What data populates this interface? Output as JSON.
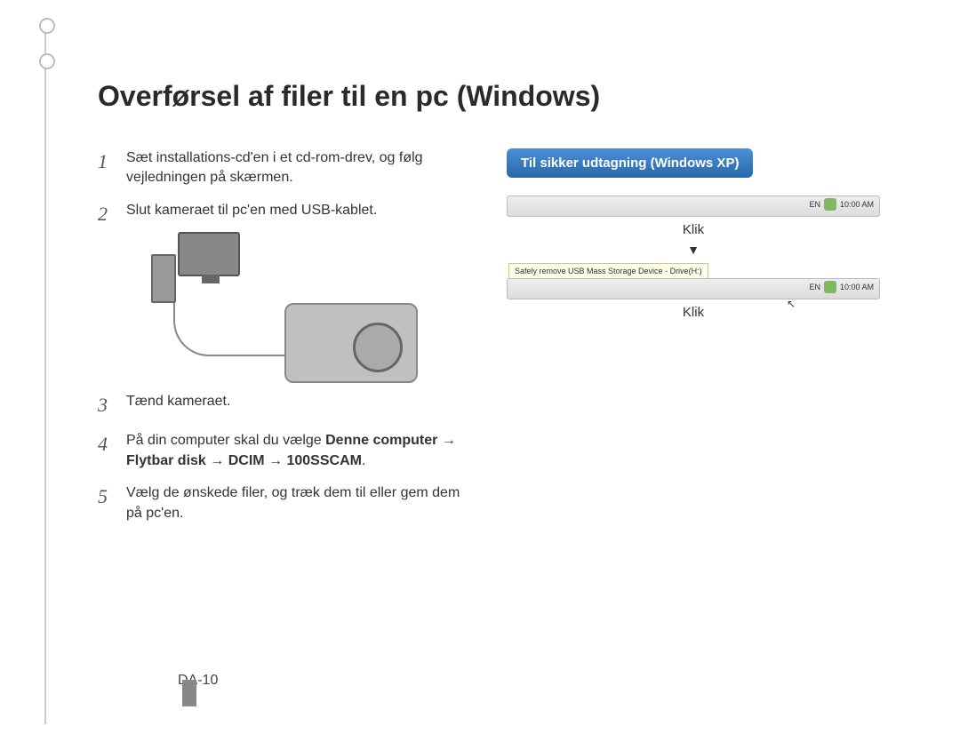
{
  "title": "Overførsel af filer til en pc (Windows)",
  "steps": {
    "s1_num": "1",
    "s1": "Sæt installations-cd'en i et cd-rom-drev, og følg vejledningen på skærmen.",
    "s2_num": "2",
    "s2": "Slut kameraet til pc'en med USB-kablet.",
    "s3_num": "3",
    "s3": "Tænd kameraet.",
    "s4_num": "4",
    "s4_pre": "På din computer skal du vælge ",
    "s4_b1": "Denne computer",
    "s4_arrow": " → ",
    "s4_b2": "Flytbar disk",
    "s4_b3": "DCIM",
    "s4_b4": "100SSCAM",
    "s4_dot": ".",
    "s5_num": "5",
    "s5": "Vælg de ønskede filer, og træk dem til eller gem dem på pc'en."
  },
  "sidebar": {
    "heading": "Til sikker udtagning (Windows XP)",
    "click": "Klik",
    "balloon": "Safely remove USB Mass Storage Device - Drive(H:)",
    "tb_lang": "EN",
    "tb_time": "10:00 AM"
  },
  "page_num": "DA-10"
}
